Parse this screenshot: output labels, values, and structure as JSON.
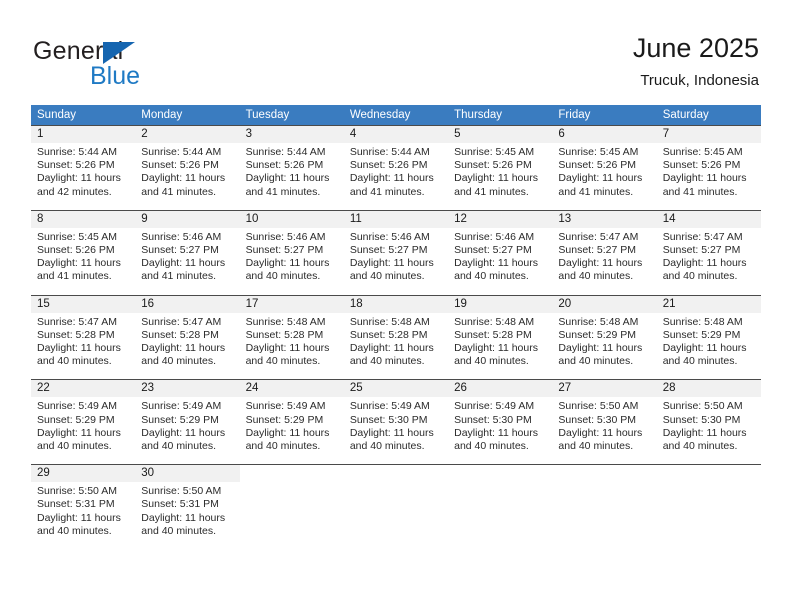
{
  "brand": {
    "name_part1": "General",
    "name_part2": "Blue",
    "triangle_color": "#1565b0",
    "blue_color": "#1f7ac4"
  },
  "header": {
    "title": "June 2025",
    "subtitle": "Trucuk, Indonesia"
  },
  "theme": {
    "header_row_bg": "#3a7cc0",
    "day_number_bg": "#f1f1f1",
    "row_border": "#4a4a4a"
  },
  "weekdays": [
    "Sunday",
    "Monday",
    "Tuesday",
    "Wednesday",
    "Thursday",
    "Friday",
    "Saturday"
  ],
  "weeks": [
    [
      {
        "day": "1",
        "sunrise": "Sunrise: 5:44 AM",
        "sunset": "Sunset: 5:26 PM",
        "daylight": "Daylight: 11 hours and 42 minutes."
      },
      {
        "day": "2",
        "sunrise": "Sunrise: 5:44 AM",
        "sunset": "Sunset: 5:26 PM",
        "daylight": "Daylight: 11 hours and 41 minutes."
      },
      {
        "day": "3",
        "sunrise": "Sunrise: 5:44 AM",
        "sunset": "Sunset: 5:26 PM",
        "daylight": "Daylight: 11 hours and 41 minutes."
      },
      {
        "day": "4",
        "sunrise": "Sunrise: 5:44 AM",
        "sunset": "Sunset: 5:26 PM",
        "daylight": "Daylight: 11 hours and 41 minutes."
      },
      {
        "day": "5",
        "sunrise": "Sunrise: 5:45 AM",
        "sunset": "Sunset: 5:26 PM",
        "daylight": "Daylight: 11 hours and 41 minutes."
      },
      {
        "day": "6",
        "sunrise": "Sunrise: 5:45 AM",
        "sunset": "Sunset: 5:26 PM",
        "daylight": "Daylight: 11 hours and 41 minutes."
      },
      {
        "day": "7",
        "sunrise": "Sunrise: 5:45 AM",
        "sunset": "Sunset: 5:26 PM",
        "daylight": "Daylight: 11 hours and 41 minutes."
      }
    ],
    [
      {
        "day": "8",
        "sunrise": "Sunrise: 5:45 AM",
        "sunset": "Sunset: 5:26 PM",
        "daylight": "Daylight: 11 hours and 41 minutes."
      },
      {
        "day": "9",
        "sunrise": "Sunrise: 5:46 AM",
        "sunset": "Sunset: 5:27 PM",
        "daylight": "Daylight: 11 hours and 41 minutes."
      },
      {
        "day": "10",
        "sunrise": "Sunrise: 5:46 AM",
        "sunset": "Sunset: 5:27 PM",
        "daylight": "Daylight: 11 hours and 40 minutes."
      },
      {
        "day": "11",
        "sunrise": "Sunrise: 5:46 AM",
        "sunset": "Sunset: 5:27 PM",
        "daylight": "Daylight: 11 hours and 40 minutes."
      },
      {
        "day": "12",
        "sunrise": "Sunrise: 5:46 AM",
        "sunset": "Sunset: 5:27 PM",
        "daylight": "Daylight: 11 hours and 40 minutes."
      },
      {
        "day": "13",
        "sunrise": "Sunrise: 5:47 AM",
        "sunset": "Sunset: 5:27 PM",
        "daylight": "Daylight: 11 hours and 40 minutes."
      },
      {
        "day": "14",
        "sunrise": "Sunrise: 5:47 AM",
        "sunset": "Sunset: 5:27 PM",
        "daylight": "Daylight: 11 hours and 40 minutes."
      }
    ],
    [
      {
        "day": "15",
        "sunrise": "Sunrise: 5:47 AM",
        "sunset": "Sunset: 5:28 PM",
        "daylight": "Daylight: 11 hours and 40 minutes."
      },
      {
        "day": "16",
        "sunrise": "Sunrise: 5:47 AM",
        "sunset": "Sunset: 5:28 PM",
        "daylight": "Daylight: 11 hours and 40 minutes."
      },
      {
        "day": "17",
        "sunrise": "Sunrise: 5:48 AM",
        "sunset": "Sunset: 5:28 PM",
        "daylight": "Daylight: 11 hours and 40 minutes."
      },
      {
        "day": "18",
        "sunrise": "Sunrise: 5:48 AM",
        "sunset": "Sunset: 5:28 PM",
        "daylight": "Daylight: 11 hours and 40 minutes."
      },
      {
        "day": "19",
        "sunrise": "Sunrise: 5:48 AM",
        "sunset": "Sunset: 5:28 PM",
        "daylight": "Daylight: 11 hours and 40 minutes."
      },
      {
        "day": "20",
        "sunrise": "Sunrise: 5:48 AM",
        "sunset": "Sunset: 5:29 PM",
        "daylight": "Daylight: 11 hours and 40 minutes."
      },
      {
        "day": "21",
        "sunrise": "Sunrise: 5:48 AM",
        "sunset": "Sunset: 5:29 PM",
        "daylight": "Daylight: 11 hours and 40 minutes."
      }
    ],
    [
      {
        "day": "22",
        "sunrise": "Sunrise: 5:49 AM",
        "sunset": "Sunset: 5:29 PM",
        "daylight": "Daylight: 11 hours and 40 minutes."
      },
      {
        "day": "23",
        "sunrise": "Sunrise: 5:49 AM",
        "sunset": "Sunset: 5:29 PM",
        "daylight": "Daylight: 11 hours and 40 minutes."
      },
      {
        "day": "24",
        "sunrise": "Sunrise: 5:49 AM",
        "sunset": "Sunset: 5:29 PM",
        "daylight": "Daylight: 11 hours and 40 minutes."
      },
      {
        "day": "25",
        "sunrise": "Sunrise: 5:49 AM",
        "sunset": "Sunset: 5:30 PM",
        "daylight": "Daylight: 11 hours and 40 minutes."
      },
      {
        "day": "26",
        "sunrise": "Sunrise: 5:49 AM",
        "sunset": "Sunset: 5:30 PM",
        "daylight": "Daylight: 11 hours and 40 minutes."
      },
      {
        "day": "27",
        "sunrise": "Sunrise: 5:50 AM",
        "sunset": "Sunset: 5:30 PM",
        "daylight": "Daylight: 11 hours and 40 minutes."
      },
      {
        "day": "28",
        "sunrise": "Sunrise: 5:50 AM",
        "sunset": "Sunset: 5:30 PM",
        "daylight": "Daylight: 11 hours and 40 minutes."
      }
    ],
    [
      {
        "day": "29",
        "sunrise": "Sunrise: 5:50 AM",
        "sunset": "Sunset: 5:31 PM",
        "daylight": "Daylight: 11 hours and 40 minutes."
      },
      {
        "day": "30",
        "sunrise": "Sunrise: 5:50 AM",
        "sunset": "Sunset: 5:31 PM",
        "daylight": "Daylight: 11 hours and 40 minutes."
      },
      {
        "day": "",
        "sunrise": "",
        "sunset": "",
        "daylight": ""
      },
      {
        "day": "",
        "sunrise": "",
        "sunset": "",
        "daylight": ""
      },
      {
        "day": "",
        "sunrise": "",
        "sunset": "",
        "daylight": ""
      },
      {
        "day": "",
        "sunrise": "",
        "sunset": "",
        "daylight": ""
      },
      {
        "day": "",
        "sunrise": "",
        "sunset": "",
        "daylight": ""
      }
    ]
  ]
}
